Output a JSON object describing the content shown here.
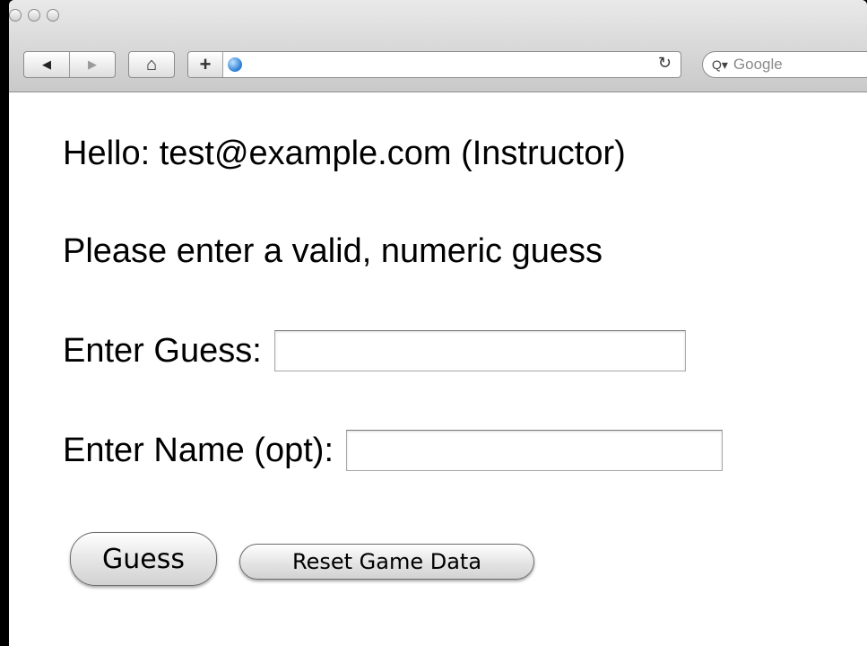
{
  "browser": {
    "back_glyph": "◀",
    "forward_glyph": "▶",
    "home_glyph": "⌂",
    "add_bookmark_glyph": "+",
    "reload_glyph": "↻",
    "search_prefix": "Q▾",
    "search_placeholder": "Google",
    "address_value": ""
  },
  "page": {
    "greeting": "Hello: test@example.com (Instructor)",
    "message": "Please enter a valid, numeric guess",
    "guess_label": "Enter Guess:",
    "guess_value": "",
    "name_label": "Enter Name (opt):",
    "name_value": "",
    "guess_button_label": "Guess",
    "reset_button_label": "Reset Game Data"
  },
  "colors": {
    "window_background": "#ffffff",
    "chrome_gradient_top": "#e9e9e9",
    "chrome_gradient_bottom": "#c9c9c9",
    "outer_background": "#000000"
  }
}
